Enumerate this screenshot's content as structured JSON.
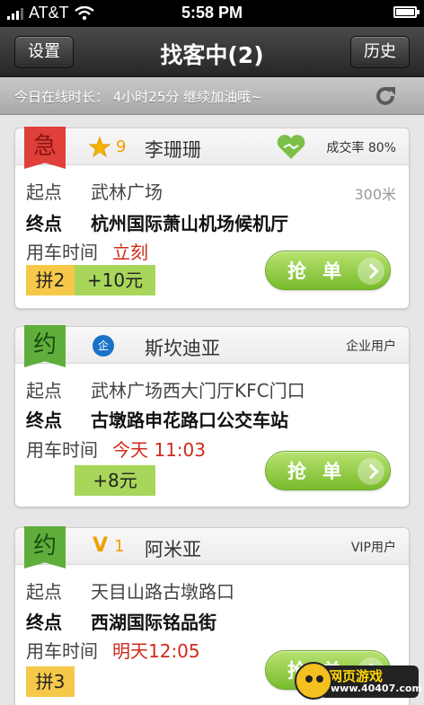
{
  "status_bar": {
    "carrier": "AT&T",
    "time": "5:58 PM"
  },
  "nav": {
    "left_button": "设置",
    "title": "找客中(2)",
    "right_button": "历史"
  },
  "info": {
    "online_text": "今日在线时长：  4小时25分    继续加油哦~"
  },
  "orders": [
    {
      "tag": "急",
      "rating": "9",
      "name": "李珊珊",
      "success_rate": "成交率 80%",
      "start_label": "起点",
      "start": "武林广场",
      "distance": "300米",
      "end_label": "终点",
      "end": "杭州国际萧山机场候机厅",
      "time_label": "用车时间",
      "time": "立刻",
      "carpool": "拼2",
      "tip": "+10元",
      "grab": "抢单"
    },
    {
      "tag": "约",
      "badge": "企",
      "name": "斯坎迪亚",
      "user_type": "企业用户",
      "start_label": "起点",
      "start": "武林广场西大门厅KFC门口",
      "end_label": "终点",
      "end": "古墩路申花路口公交车站",
      "time_label": "用车时间",
      "time": "今天 11:03",
      "tip": "+8元",
      "grab": "抢单"
    },
    {
      "tag": "约",
      "vip_mark": "V",
      "vip_level": "1",
      "name": "阿米亚",
      "user_type": "VIP用户",
      "start_label": "起点",
      "start": "天目山路古墩路口",
      "end_label": "终点",
      "end": "西湖国际铭品街",
      "time_label": "用车时间",
      "time": "明天12:05",
      "carpool": "拼3",
      "grab": "抢单"
    }
  ],
  "watermark": {
    "line1": "网页游戏",
    "line2": "www.40407.com"
  },
  "colors": {
    "urgent": "#e03f3a",
    "booked": "#5fae3c",
    "grab": "#8cc63f",
    "time_red": "#d02a1a",
    "chip_yellow": "#f6c84a",
    "chip_green": "#a8d65a"
  }
}
